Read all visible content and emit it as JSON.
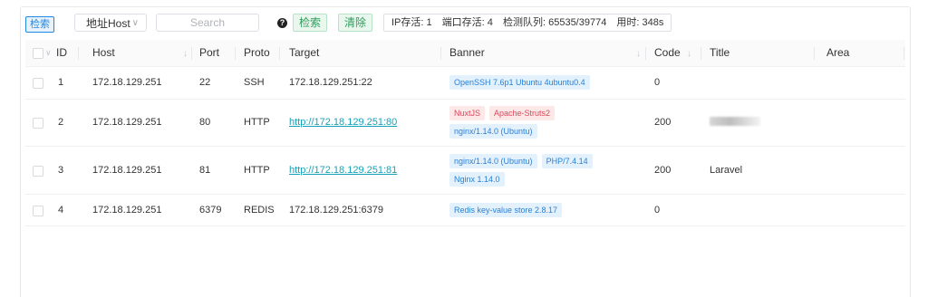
{
  "toolbar": {
    "search_tag": "检索",
    "select_value": "地址Host",
    "search_placeholder": "Search",
    "search_button": "检索",
    "clear_button": "清除",
    "status": {
      "ip_alive": "IP存活: 1",
      "port_alive": "端口存活: 4",
      "queue": "检测队列: 65535/39774",
      "elapsed": "用时: 348s"
    }
  },
  "table": {
    "columns": [
      "ID",
      "Host",
      "Port",
      "Proto",
      "Target",
      "Banner",
      "Code",
      "Title",
      "Area"
    ],
    "rows": [
      {
        "id": "1",
        "host": "172.18.129.251",
        "port": "22",
        "proto": "SSH",
        "target": "172.18.129.251:22",
        "target_is_link": false,
        "banners": [
          {
            "text": "OpenSSH 7.6p1 Ubuntu 4ubuntu0.4",
            "color": "blue"
          }
        ],
        "code": "0",
        "title": "",
        "area": ""
      },
      {
        "id": "2",
        "host": "172.18.129.251",
        "port": "80",
        "proto": "HTTP",
        "target": "http://172.18.129.251:80",
        "target_is_link": true,
        "banners": [
          {
            "text": "NuxtJS",
            "color": "red"
          },
          {
            "text": "Apache-Struts2",
            "color": "red"
          },
          {
            "text": "nginx/1.14.0 (Ubuntu)",
            "color": "blue"
          }
        ],
        "code": "200",
        "title": "",
        "title_redacted": true,
        "area": ""
      },
      {
        "id": "3",
        "host": "172.18.129.251",
        "port": "81",
        "proto": "HTTP",
        "target": "http://172.18.129.251:81",
        "target_is_link": true,
        "banners": [
          {
            "text": "nginx/1.14.0 (Ubuntu)",
            "color": "blue"
          },
          {
            "text": "PHP/7.4.14",
            "color": "blue"
          },
          {
            "text": "Nginx 1.14.0",
            "color": "blue"
          }
        ],
        "code": "200",
        "title": "Laravel",
        "area": ""
      },
      {
        "id": "4",
        "host": "172.18.129.251",
        "port": "6379",
        "proto": "REDIS",
        "target": "172.18.129.251:6379",
        "target_is_link": false,
        "banners": [
          {
            "text": "Redis key-value store 2.8.17",
            "color": "blue"
          }
        ],
        "code": "0",
        "title": "",
        "area": ""
      }
    ]
  },
  "colors": {
    "accent_blue": "#1e88e5",
    "link": "#17a2b8",
    "tag_blue_bg": "#e3f1fd",
    "tag_red_bg": "#fde8e8",
    "green_button": "#2e9d5a"
  }
}
